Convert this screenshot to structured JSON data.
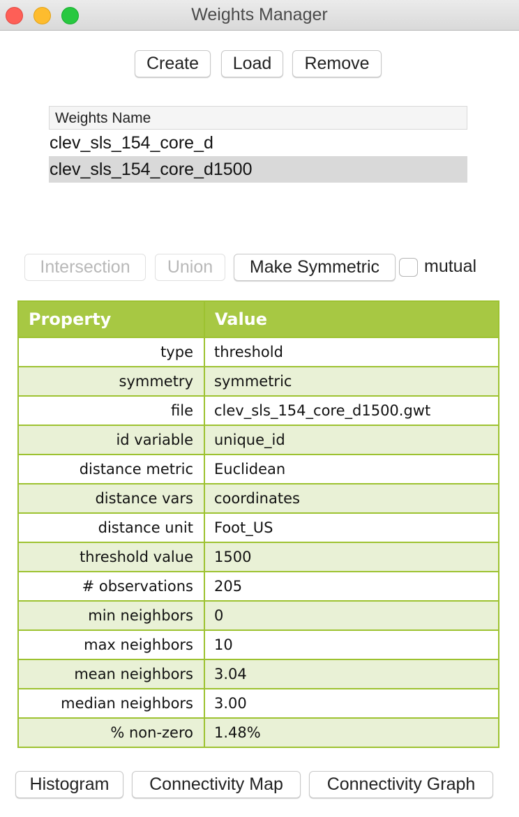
{
  "window": {
    "title": "Weights Manager",
    "controls": [
      "close",
      "minimize",
      "maximize"
    ]
  },
  "toolbar": {
    "create_label": "Create",
    "load_label": "Load",
    "remove_label": "Remove"
  },
  "weights_list": {
    "header": "Weights Name",
    "items": [
      {
        "name": "clev_sls_154_core_d",
        "selected": false
      },
      {
        "name": "clev_sls_154_core_d1500",
        "selected": true
      }
    ]
  },
  "operations": {
    "intersection_label": "Intersection",
    "intersection_enabled": false,
    "union_label": "Union",
    "union_enabled": false,
    "make_symmetric_label": "Make Symmetric",
    "mutual_label": "mutual",
    "mutual_checked": false
  },
  "properties": {
    "header_property": "Property",
    "header_value": "Value",
    "header_color": "#a7c843",
    "alt_row_color": "#e9f1d6",
    "rows": [
      {
        "key": "type",
        "value": "threshold"
      },
      {
        "key": "symmetry",
        "value": "symmetric"
      },
      {
        "key": "file",
        "value": "clev_sls_154_core_d1500.gwt"
      },
      {
        "key": "id variable",
        "value": "unique_id"
      },
      {
        "key": "distance metric",
        "value": "Euclidean"
      },
      {
        "key": "distance vars",
        "value": "coordinates"
      },
      {
        "key": "distance unit",
        "value": "Foot_US"
      },
      {
        "key": "threshold value",
        "value": "1500"
      },
      {
        "key": "# observations",
        "value": "205"
      },
      {
        "key": "min neighbors",
        "value": "0"
      },
      {
        "key": "max neighbors",
        "value": "10"
      },
      {
        "key": "mean neighbors",
        "value": "3.04"
      },
      {
        "key": "median neighbors",
        "value": "3.00"
      },
      {
        "key": "% non-zero",
        "value": "1.48%"
      }
    ]
  },
  "bottom_buttons": {
    "histogram_label": "Histogram",
    "connectivity_map_label": "Connectivity Map",
    "connectivity_graph_label": "Connectivity Graph"
  }
}
